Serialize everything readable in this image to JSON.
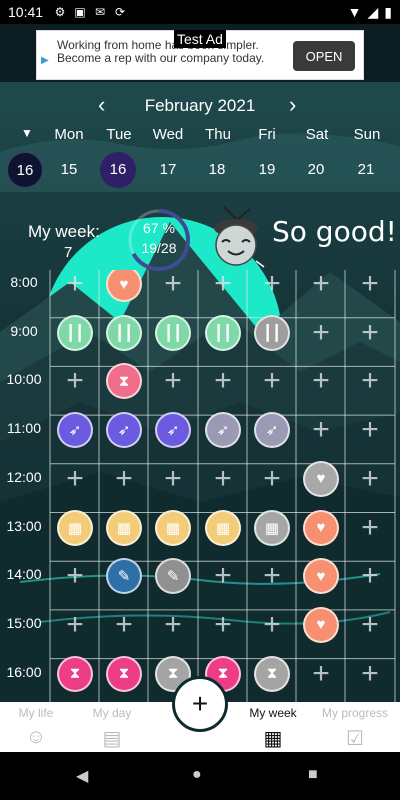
{
  "status_bar": {
    "time": "10:41",
    "icons": [
      "gear-icon",
      "cast-icon",
      "mail-icon",
      "sync-icon"
    ],
    "right_icons": [
      "wifi-icon",
      "signal-icon",
      "battery-icon"
    ]
  },
  "ad": {
    "label": "Test Ad",
    "text": "Working from home has been simpler. Become a rep with our company today.",
    "button": "OPEN"
  },
  "calendar": {
    "month_title": "February 2021",
    "weekdays": [
      "Mon",
      "Tue",
      "Wed",
      "Thu",
      "Fri",
      "Sat",
      "Sun"
    ],
    "today_date": "16",
    "dates": [
      "15",
      "16",
      "17",
      "18",
      "19",
      "20",
      "21"
    ],
    "selected_index": 1
  },
  "summary": {
    "title": "My week:",
    "sub": "7",
    "percent": "67 %",
    "count": "19/28",
    "progress": 0.67,
    "cheer": "So good!"
  },
  "schedule": {
    "times": [
      "8:00",
      "9:00",
      "10:00",
      "11:00",
      "12:00",
      "13:00",
      "14:00",
      "15:00",
      "16:00"
    ],
    "rows": [
      [
        "plus",
        "heart-orange",
        "plus",
        "plus",
        "plus",
        "plus",
        "plus"
      ],
      [
        "dumbbell-green",
        "dumbbell-green",
        "dumbbell-green",
        "dumbbell-green",
        "dumbbell-gray",
        "plus",
        "plus"
      ],
      [
        "plus",
        "hourglass-pink",
        "plus",
        "plus",
        "plus",
        "plus",
        "plus"
      ],
      [
        "rocket-purple",
        "rocket-purple",
        "rocket-purple",
        "rocket-gray",
        "rocket-gray",
        "plus",
        "plus"
      ],
      [
        "plus",
        "plus",
        "plus",
        "plus",
        "plus",
        "heart-gray",
        "plus"
      ],
      [
        "film-yellow",
        "film-yellow",
        "film-yellow",
        "film-yellow",
        "film-gray",
        "heart-orange",
        "plus"
      ],
      [
        "plus",
        "brush-blue",
        "brush-gray",
        "plus",
        "plus",
        "heart-orange",
        "plus"
      ],
      [
        "plus",
        "plus",
        "plus",
        "plus",
        "plus",
        "heart-orange",
        "plus"
      ],
      [
        "hourglass-magenta",
        "hourglass-magenta",
        "hourglass-gray",
        "hourglass-magenta",
        "hourglass-gray",
        "plus",
        "plus"
      ]
    ],
    "colors": {
      "heart-orange": "#f79070",
      "heart-gray": "#a8a8a8",
      "dumbbell-green": "#7fd8a8",
      "dumbbell-gray": "#9e9e9e",
      "hourglass-pink": "#f06e8c",
      "hourglass-magenta": "#ee3d87",
      "hourglass-gray": "#a4a4a4",
      "rocket-purple": "#6a5be0",
      "rocket-gray": "#9a9ab5",
      "film-yellow": "#f2cc78",
      "film-gray": "#a6a6a6",
      "brush-blue": "#2f6fa8",
      "brush-gray": "#909090"
    }
  },
  "bottom_nav": {
    "tabs": [
      "My life",
      "My day",
      "",
      "My week",
      "My progress"
    ],
    "active_index": 3,
    "fab": "+"
  }
}
